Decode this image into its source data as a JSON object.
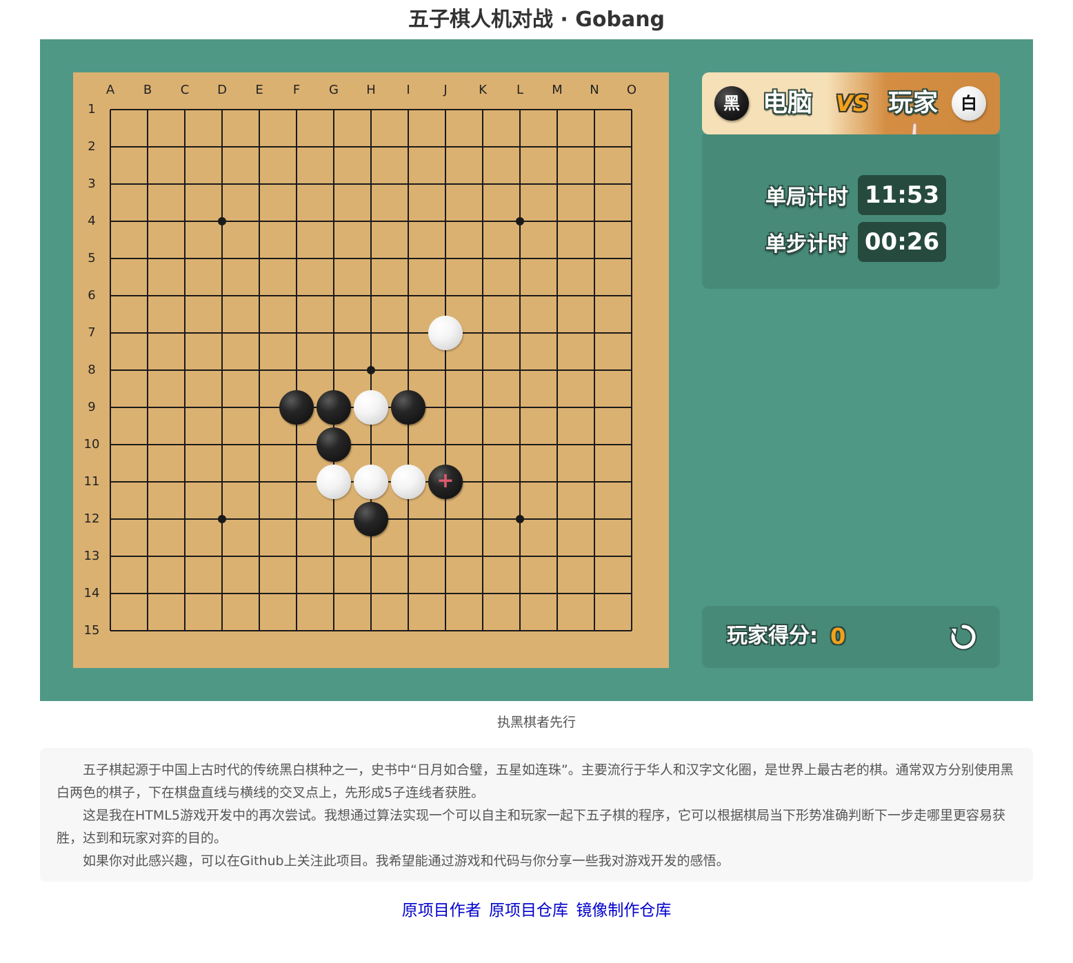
{
  "header": {
    "title": "五子棋人机对战 · Gobang"
  },
  "board": {
    "columns": [
      "A",
      "B",
      "C",
      "D",
      "E",
      "F",
      "G",
      "H",
      "I",
      "J",
      "K",
      "L",
      "M",
      "N",
      "O"
    ],
    "rows": [
      "1",
      "2",
      "3",
      "4",
      "5",
      "6",
      "7",
      "8",
      "9",
      "10",
      "11",
      "12",
      "13",
      "14",
      "15"
    ],
    "star_points": [
      "D4",
      "L4",
      "H8",
      "D12",
      "L12"
    ],
    "stones": [
      {
        "pos": "J7",
        "color": "white"
      },
      {
        "pos": "F9",
        "color": "black"
      },
      {
        "pos": "G9",
        "color": "black"
      },
      {
        "pos": "H9",
        "color": "white"
      },
      {
        "pos": "I9",
        "color": "black"
      },
      {
        "pos": "G10",
        "color": "black"
      },
      {
        "pos": "G11",
        "color": "white"
      },
      {
        "pos": "H11",
        "color": "white"
      },
      {
        "pos": "I11",
        "color": "white"
      },
      {
        "pos": "J11",
        "color": "black",
        "last_move": true
      },
      {
        "pos": "H12",
        "color": "black"
      }
    ],
    "last_move_marker": "+"
  },
  "vs_bar": {
    "left_avatar": "黑",
    "left_name": "电脑",
    "vs": "VS",
    "right_name": "玩家",
    "right_avatar": "白",
    "turn_indicator_icon": "pointing-hand-icon"
  },
  "timers": {
    "game_label": "单局计时",
    "game_value": "11:53",
    "step_label": "单步计时",
    "step_value": "00:26"
  },
  "score": {
    "label": "玩家得分:",
    "value": "0",
    "restart_icon": "restart-icon"
  },
  "hint": "执黑棋者先行",
  "description": {
    "paragraphs": [
      "五子棋起源于中国上古时代的传统黑白棋种之一，史书中“日月如合璧，五星如连珠”。主要流行于华人和汉字文化圈，是世界上最古老的棋。通常双方分别使用黑白两色的棋子，下在棋盘直线与横线的交叉点上，先形成5子连线者获胜。",
      "这是我在HTML5游戏开发中的再次尝试。我想通过算法实现一个可以自主和玩家一起下五子棋的程序，它可以根据棋局当下形势准确判断下一步走哪里更容易获胜，达到和玩家对弈的目的。",
      "如果你对此感兴趣，可以在Github上关注此项目。我希望能通过游戏和代码与你分享一些我对游戏开发的感悟。"
    ]
  },
  "links": {
    "author": "原项目作者",
    "repo": "原项目仓库",
    "mirror": "镜像制作仓库"
  },
  "colors": {
    "stage_bg": "#4f9886",
    "board_bg": "#dbb171",
    "accent_orange": "#f3a11b",
    "timer_bg": "#264a3e",
    "link": "#0000cc"
  }
}
